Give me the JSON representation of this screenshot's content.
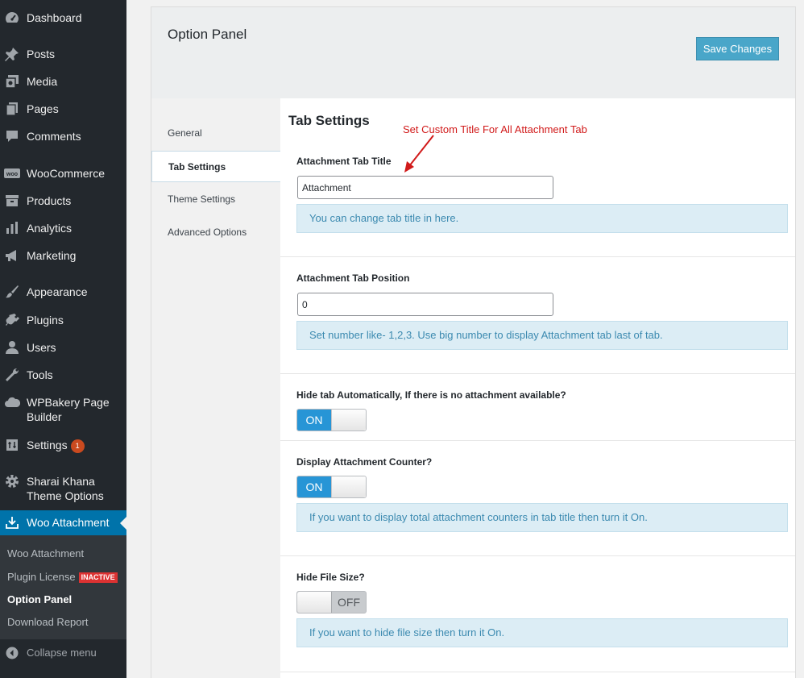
{
  "sidebar": {
    "items": [
      {
        "label": "Dashboard",
        "icon": "dashboard-icon"
      },
      {
        "label": "Posts",
        "icon": "pin-icon"
      },
      {
        "label": "Media",
        "icon": "media-icon"
      },
      {
        "label": "Pages",
        "icon": "pages-icon"
      },
      {
        "label": "Comments",
        "icon": "comment-icon"
      },
      {
        "label": "WooCommerce",
        "icon": "woo-icon"
      },
      {
        "label": "Products",
        "icon": "archive-icon"
      },
      {
        "label": "Analytics",
        "icon": "bar-chart-icon"
      },
      {
        "label": "Marketing",
        "icon": "megaphone-icon"
      },
      {
        "label": "Appearance",
        "icon": "brush-icon"
      },
      {
        "label": "Plugins",
        "icon": "plug-icon"
      },
      {
        "label": "Users",
        "icon": "user-icon"
      },
      {
        "label": "Tools",
        "icon": "wrench-icon"
      },
      {
        "label": "WPBakery Page Builder",
        "icon": "cloud-icon"
      },
      {
        "label": "Settings",
        "icon": "settings-icon",
        "badge": "1"
      },
      {
        "label": "Sharai Khana Theme Options",
        "icon": "gear-icon"
      },
      {
        "label": "Woo Attachment",
        "icon": "download-icon"
      }
    ],
    "submenu": [
      {
        "label": "Woo Attachment"
      },
      {
        "label": "Plugin License",
        "tag": "INACTIVE"
      },
      {
        "label": "Option Panel"
      },
      {
        "label": "Download Report"
      }
    ],
    "collapse_label": "Collapse menu",
    "colors": {
      "background": "#23282d",
      "current": "#0073aa",
      "submenu": "#32373c",
      "badge": "#ca4a1f"
    }
  },
  "panel": {
    "title": "Option Panel",
    "save_label": "Save Changes",
    "tabs": [
      {
        "label": "General"
      },
      {
        "label": "Tab Settings"
      },
      {
        "label": "Theme Settings"
      },
      {
        "label": "Advanced Options"
      }
    ],
    "active_tab": "Tab Settings",
    "content_title": "Tab Settings",
    "annotation": "Set Custom Title For All Attachment Tab",
    "fields": {
      "tab_title": {
        "label": "Attachment Tab Title",
        "value": "Attachment",
        "help": "You can change tab title in here."
      },
      "tab_position": {
        "label": "Attachment Tab Position",
        "value": "0",
        "help": "Set number like- 1,2,3. Use big number to display Attachment tab last of tab."
      },
      "hide_tab": {
        "label": "Hide tab Automatically, If there is no attachment available?",
        "state": "ON"
      },
      "display_counter": {
        "label": "Display Attachment Counter?",
        "state": "ON",
        "help": "If you want to display total attachment counters in tab title then turn it On."
      },
      "hide_size": {
        "label": "Hide File Size?",
        "state": "OFF",
        "help": "If you want to hide file size then turn it On."
      }
    },
    "colors": {
      "accent": "#49a6c9",
      "switch_on": "#2795d6",
      "help_bg": "#dcedf5",
      "annotation": "#d11a1a"
    }
  }
}
